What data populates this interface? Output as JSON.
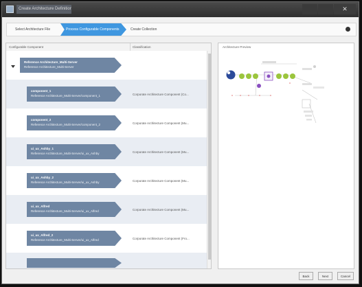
{
  "window": {
    "title": "Create Architecture Definition",
    "close_glyph": "✕"
  },
  "wizard": {
    "steps": [
      "Select Architecture File",
      "Process Configurable Components",
      "Create Collection"
    ],
    "help_icon": "gear-icon"
  },
  "grid": {
    "headers": [
      "Configurable Component",
      "Classification"
    ],
    "root": {
      "name": "Reference Architecture_Multi-Server",
      "sub": "Reference Architecture_Multi-Server"
    },
    "rows": [
      {
        "name": "component_1",
        "sub": "Reference Architecture_Multi-Server/component_1",
        "classification": "Corporate Architecture Component (Co..."
      },
      {
        "name": "component_2",
        "sub": "Reference Architecture_Multi-Server/component_2",
        "classification": "Corporate Architecture Component (Mu..."
      },
      {
        "name": "ui_ux_Ashby_1",
        "sub": "Reference Architecture_Multi-Server/ui_ux_Ashby",
        "classification": "Corporate Architecture Component (Mu..."
      },
      {
        "name": "ui_ux_Ashby_2",
        "sub": "Reference Architecture_Multi-Server/ui_ux_Ashby",
        "classification": "Corporate Architecture Component (Mu..."
      },
      {
        "name": "ui_ux_Alfred",
        "sub": "Reference Architecture_Multi-Server/ui_ux_Alfred",
        "classification": "Corporate Architecture Component (Mu..."
      },
      {
        "name": "ui_ux_Alfred_2",
        "sub": "Reference Architecture_Multi-Server/ui_ux_Alfred",
        "classification": "Corporate Architecture Component (Fro..."
      }
    ]
  },
  "preview": {
    "title": "Architecture Preview"
  },
  "footer": {
    "back": "Back",
    "next": "Next",
    "cancel": "Cancel"
  },
  "colors": {
    "accent": "#3f97e0",
    "tag": "#6f86a3",
    "node_green": "#9bc53d",
    "node_blue": "#2b4a9a",
    "node_purple": "#8a4fc0"
  }
}
